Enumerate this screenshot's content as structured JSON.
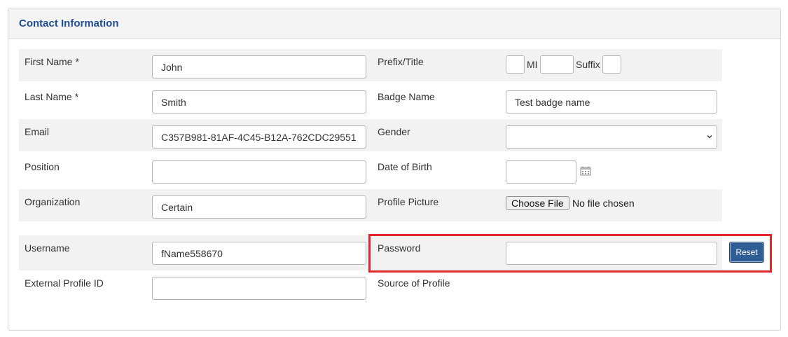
{
  "panel": {
    "title": "Contact Information"
  },
  "fields": {
    "first_name": {
      "label": "First Name",
      "required_mark": "*",
      "value": "John"
    },
    "last_name": {
      "label": "Last Name",
      "required_mark": "*",
      "value": "Smith"
    },
    "email": {
      "label": "Email",
      "value": "C357B981-81AF-4C45-B12A-762CDC29551"
    },
    "position": {
      "label": "Position",
      "value": ""
    },
    "organization": {
      "label": "Organization",
      "value": "Certain"
    },
    "username": {
      "label": "Username",
      "value": "fName558670"
    },
    "external_profile_id": {
      "label": "External Profile ID",
      "value": ""
    },
    "prefix_title": {
      "label": "Prefix/Title",
      "value": "",
      "mi_label": "MI",
      "mi_value": "",
      "suffix_label": "Suffix",
      "suffix_value": ""
    },
    "badge_name": {
      "label": "Badge Name",
      "value": "Test badge name"
    },
    "gender": {
      "label": "Gender",
      "selected": ""
    },
    "date_of_birth": {
      "label": "Date of Birth",
      "value": ""
    },
    "profile_picture": {
      "label": "Profile Picture",
      "button_label": "Choose File",
      "status": "No file chosen"
    },
    "password": {
      "label": "Password",
      "value": "",
      "reset_label": "Reset"
    },
    "source_of_profile": {
      "label": "Source of Profile"
    }
  },
  "colors": {
    "title": "#1f4e96",
    "reset_button": "#2f5d95",
    "highlight": "#e0292b",
    "row_background": "#f2f2f2"
  },
  "icons": {
    "calendar": "calendar-icon",
    "dropdown": "chevron-down-icon"
  }
}
